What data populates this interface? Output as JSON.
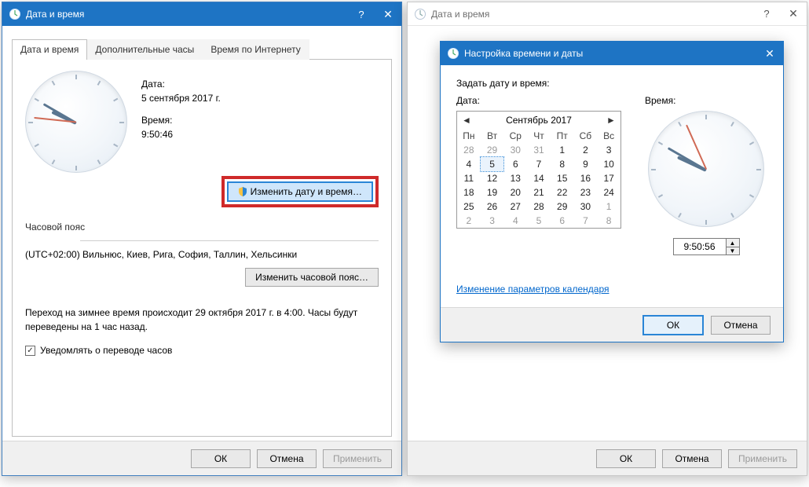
{
  "left_window": {
    "title": "Дата и время",
    "tabs": [
      "Дата и время",
      "Дополнительные часы",
      "Время по Интернету"
    ],
    "date_label": "Дата:",
    "date_value": "5 сентября 2017 г.",
    "time_label": "Время:",
    "time_value": "9:50:46",
    "change_dt_button": "Изменить дату и время…",
    "tz_section_title": "Часовой пояс",
    "tz_value": "(UTC+02:00) Вильнюс, Киев, Рига, София, Таллин, Хельсинки",
    "change_tz_button": "Изменить часовой пояс…",
    "dst_text": "Переход на зимнее время происходит 29 октября 2017 г. в 4:00. Часы будут переведены на 1 час назад.",
    "notify_checkbox": "Уведомлять о переводе часов",
    "buttons": {
      "ok": "ОК",
      "cancel": "Отмена",
      "apply": "Применить"
    },
    "clock": {
      "hour_deg": 295,
      "min_deg": 300,
      "sec_deg": 276
    }
  },
  "right_window": {
    "title": "Дата и время",
    "buttons": {
      "ok": "ОК",
      "cancel": "Отмена",
      "apply": "Применить"
    }
  },
  "inner_dialog": {
    "title": "Настройка времени и даты",
    "heading": "Задать дату и время:",
    "date_label": "Дата:",
    "time_label": "Время:",
    "calendar": {
      "month_title": "Сентябрь 2017",
      "dow": [
        "Пн",
        "Вт",
        "Ср",
        "Чт",
        "Пт",
        "Сб",
        "Вс"
      ],
      "weeks": [
        [
          {
            "n": 28,
            "o": true
          },
          {
            "n": 29,
            "o": true
          },
          {
            "n": 30,
            "o": true
          },
          {
            "n": 31,
            "o": true
          },
          {
            "n": 1
          },
          {
            "n": 2
          },
          {
            "n": 3
          }
        ],
        [
          {
            "n": 4
          },
          {
            "n": 5,
            "sel": true
          },
          {
            "n": 6
          },
          {
            "n": 7
          },
          {
            "n": 8
          },
          {
            "n": 9
          },
          {
            "n": 10
          }
        ],
        [
          {
            "n": 11
          },
          {
            "n": 12
          },
          {
            "n": 13
          },
          {
            "n": 14
          },
          {
            "n": 15
          },
          {
            "n": 16
          },
          {
            "n": 17
          }
        ],
        [
          {
            "n": 18
          },
          {
            "n": 19
          },
          {
            "n": 20
          },
          {
            "n": 21
          },
          {
            "n": 22
          },
          {
            "n": 23
          },
          {
            "n": 24
          }
        ],
        [
          {
            "n": 25
          },
          {
            "n": 26
          },
          {
            "n": 27
          },
          {
            "n": 28
          },
          {
            "n": 29
          },
          {
            "n": 30
          },
          {
            "n": 1,
            "o": true
          }
        ],
        [
          {
            "n": 2,
            "o": true
          },
          {
            "n": 3,
            "o": true
          },
          {
            "n": 4,
            "o": true
          },
          {
            "n": 5,
            "o": true
          },
          {
            "n": 6,
            "o": true
          },
          {
            "n": 7,
            "o": true
          },
          {
            "n": 8,
            "o": true
          }
        ]
      ]
    },
    "time_value": "9:50:56",
    "clock": {
      "hour_deg": 295,
      "min_deg": 300,
      "sec_deg": 336
    },
    "link": "Изменение параметров календаря",
    "buttons": {
      "ok": "ОК",
      "cancel": "Отмена"
    }
  }
}
